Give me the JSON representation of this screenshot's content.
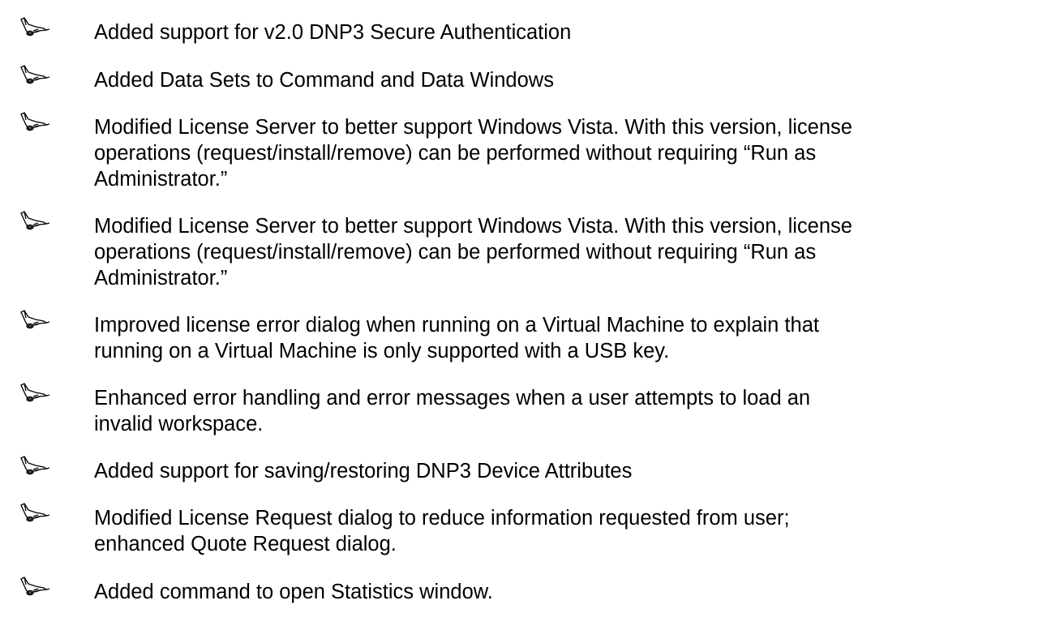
{
  "bullets": [
    {
      "lines": [
        "Added support for v2.0 DNP3 Secure Authentication"
      ]
    },
    {
      "lines": [
        "Added Data Sets to Command and Data Windows"
      ]
    },
    {
      "lines": [
        "Modified License Server to better support Windows Vista. With this version, license",
        "operations (request/install/remove) can be performed without requiring “Run as",
        "Administrator.”"
      ]
    },
    {
      "lines": [
        "Modified License Server to better support Windows Vista. With this version, license",
        "operations (request/install/remove) can be performed without requiring “Run as",
        "Administrator.”"
      ]
    },
    {
      "lines": [
        "Improved license error dialog when running on a Virtual Machine to explain that",
        "running on a Virtual Machine is only supported with a USB key."
      ]
    },
    {
      "lines": [
        "Enhanced error handling and error messages when a user attempts to load an",
        "invalid workspace."
      ]
    },
    {
      "lines": [
        "Added support for saving/restoring DNP3 Device Attributes"
      ]
    },
    {
      "lines": [
        "Modified License Request dialog to reduce information requested from user;",
        "enhanced Quote Request dialog."
      ]
    },
    {
      "lines": [
        "Added command to open Statistics window."
      ]
    }
  ],
  "bullet_icon": "pointing-hand-icon"
}
